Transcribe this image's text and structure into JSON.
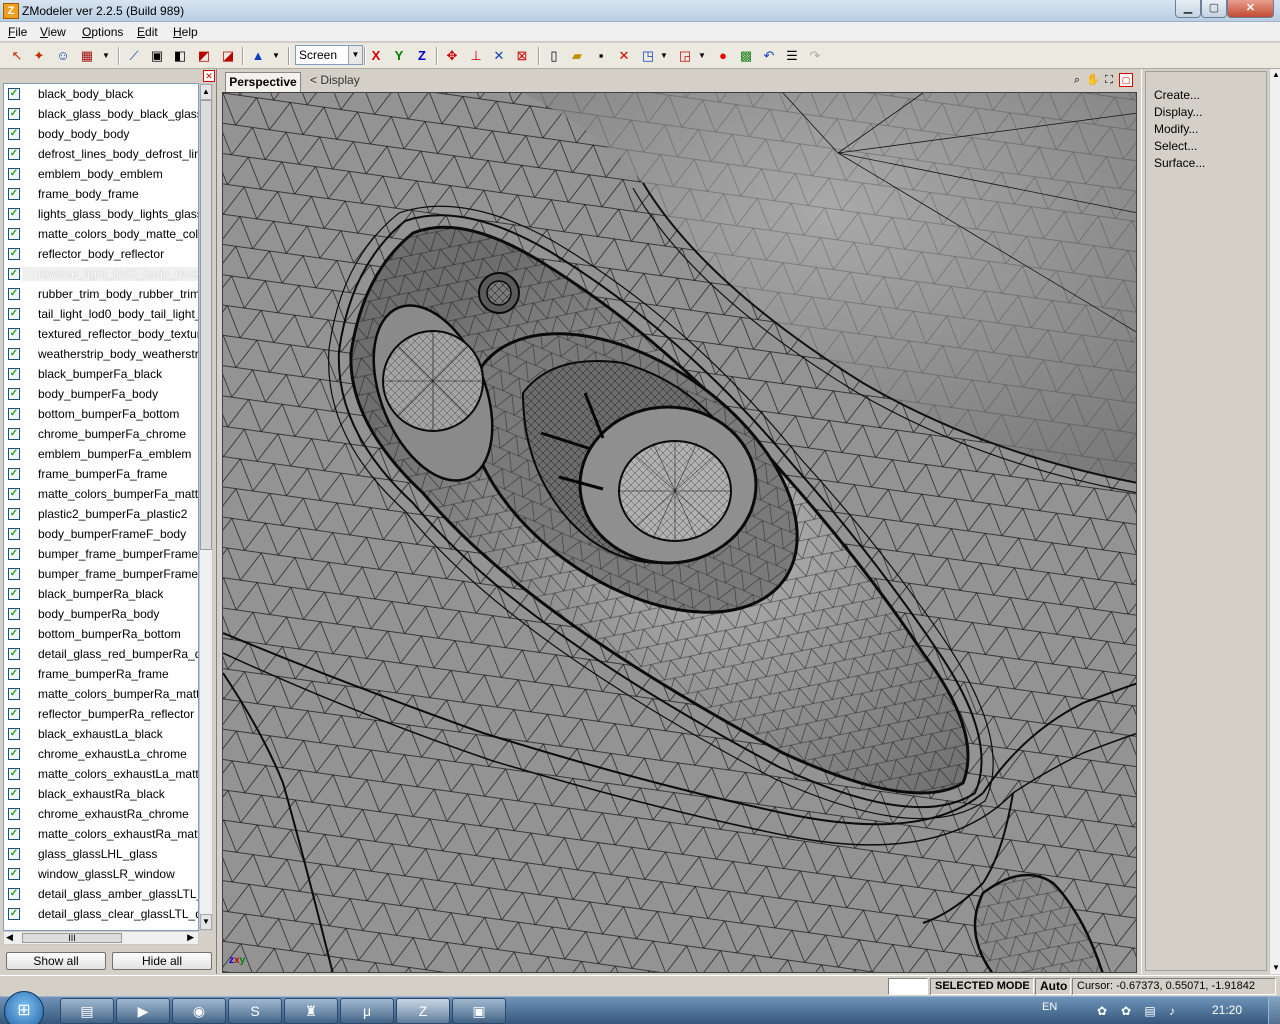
{
  "window": {
    "title": "ZModeler ver 2.2.5 (Build 989)",
    "app_icon": "Z",
    "min_glyph": "▁",
    "max_glyph": "▢",
    "close_glyph": "✕"
  },
  "menu": [
    {
      "mnemonic": "F",
      "rest": "ile"
    },
    {
      "mnemonic": "V",
      "rest": "iew"
    },
    {
      "mnemonic": "O",
      "rest": "ptions"
    },
    {
      "mnemonic": "E",
      "rest": "dit"
    },
    {
      "mnemonic": "H",
      "rest": "elp"
    }
  ],
  "toolbar": {
    "coord_system": "Screen",
    "axis_x": "X",
    "axis_y": "Y",
    "axis_z": "Z",
    "icons": [
      "select-arrow-icon",
      "pivot-icon",
      "figure-icon",
      "layers-icon",
      "vertex-icon",
      "cube-icon",
      "cube2-icon",
      "cube3-icon",
      "cube4-icon",
      "arrow-up-icon",
      "move-icon",
      "axes-icon",
      "axes2-icon",
      "axes3-icon",
      "new-file-icon",
      "open-folder-icon",
      "save-icon",
      "delete-icon",
      "import-icon",
      "export-icon",
      "record-icon",
      "material-icon",
      "undo-icon",
      "notes-icon",
      "redo-icon"
    ]
  },
  "objects": {
    "items": [
      {
        "name": "black_body_black",
        "checked": true
      },
      {
        "name": "black_glass_body_black_glass",
        "checked": true
      },
      {
        "name": "body_body_body",
        "checked": true
      },
      {
        "name": "defrost_lines_body_defrost_lin",
        "checked": true
      },
      {
        "name": "emblem_body_emblem",
        "checked": true
      },
      {
        "name": "frame_body_frame",
        "checked": true
      },
      {
        "name": "lights_glass_body_lights_glass",
        "checked": true
      },
      {
        "name": "matte_colors_body_matte_col",
        "checked": true
      },
      {
        "name": "reflector_body_reflector",
        "checked": true
      },
      {
        "name": "reverse_light_lod0_body_rever",
        "checked": true,
        "selected": true
      },
      {
        "name": "rubber_trim_body_rubber_trim",
        "checked": true
      },
      {
        "name": "tail_light_lod0_body_tail_light_",
        "checked": true
      },
      {
        "name": "textured_reflector_body_textur",
        "checked": true
      },
      {
        "name": "weatherstrip_body_weatherstr",
        "checked": true
      },
      {
        "name": "black_bumperFa_black",
        "checked": true
      },
      {
        "name": "body_bumperFa_body",
        "checked": true
      },
      {
        "name": "bottom_bumperFa_bottom",
        "checked": true
      },
      {
        "name": "chrome_bumperFa_chrome",
        "checked": true
      },
      {
        "name": "emblem_bumperFa_emblem",
        "checked": true
      },
      {
        "name": "frame_bumperFa_frame",
        "checked": true
      },
      {
        "name": "matte_colors_bumperFa_matt",
        "checked": true
      },
      {
        "name": "plastic2_bumperFa_plastic2",
        "checked": true
      },
      {
        "name": "body_bumperFrameF_body",
        "checked": true
      },
      {
        "name": "bumper_frame_bumperFrame",
        "checked": true
      },
      {
        "name": "bumper_frame_bumperFrame",
        "checked": true
      },
      {
        "name": "black_bumperRa_black",
        "checked": true
      },
      {
        "name": "body_bumperRa_body",
        "checked": true
      },
      {
        "name": "bottom_bumperRa_bottom",
        "checked": true
      },
      {
        "name": "detail_glass_red_bumperRa_de",
        "checked": true
      },
      {
        "name": "frame_bumperRa_frame",
        "checked": true
      },
      {
        "name": "matte_colors_bumperRa_matt",
        "checked": true
      },
      {
        "name": "reflector_bumperRa_reflector",
        "checked": true
      },
      {
        "name": "black_exhaustLa_black",
        "checked": true
      },
      {
        "name": "chrome_exhaustLa_chrome",
        "checked": true
      },
      {
        "name": "matte_colors_exhaustLa_matte",
        "checked": true
      },
      {
        "name": "black_exhaustRa_black",
        "checked": true
      },
      {
        "name": "chrome_exhaustRa_chrome",
        "checked": true
      },
      {
        "name": "matte_colors_exhaustRa_matte",
        "checked": true
      },
      {
        "name": "glass_glassLHL_glass",
        "checked": true
      },
      {
        "name": "window_glassLR_window",
        "checked": true
      },
      {
        "name": "detail_glass_amber_glassLTL_c",
        "checked": true
      },
      {
        "name": "detail_glass_clear_glassLTL_de",
        "checked": true
      }
    ],
    "show_all_label": "Show all",
    "hide_all_label": "Hide all",
    "close_glyph": "✕",
    "scroll_thumb_glyph": "III"
  },
  "viewport": {
    "tab_label": "Perspective",
    "display_label": "<  Display",
    "axes_label": "xyz"
  },
  "right_panel": {
    "items": [
      "Create...",
      "Display...",
      "Modify...",
      "Select...",
      "Surface..."
    ]
  },
  "status": {
    "mode": "SELECTED MODE",
    "auto": "Auto",
    "cursor": "Cursor: -0.67373, 0.55071, -1.91842"
  },
  "taskbar": {
    "apps": [
      "explorer-icon",
      "media-player-icon",
      "firefox-icon",
      "skype-icon",
      "app-icon",
      "utorrent-icon",
      "zmodeler-icon",
      "window-icon"
    ],
    "lang": "EN",
    "time": "21:20"
  },
  "colors": {
    "mesh_line": "#141414",
    "surface": "#8e8e8e",
    "accent_close": "#d00000"
  }
}
